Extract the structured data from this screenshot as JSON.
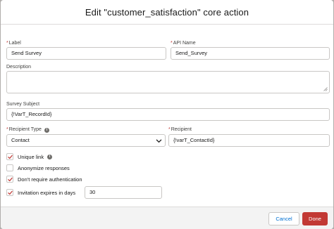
{
  "modal": {
    "title": "Edit \"customer_satisfaction\" core action"
  },
  "fields": {
    "label": {
      "label": "Label",
      "value": "Send Survey",
      "required": "*"
    },
    "api_name": {
      "label": "API Name",
      "value": "Send_Survey",
      "required": "*"
    },
    "description": {
      "label": "Description",
      "value": ""
    },
    "survey_subject": {
      "label": "Survey Subject",
      "value": "{!VarT_RecordId}"
    },
    "recipient_type": {
      "label": "Recipient Type",
      "value": "Contact",
      "required": "*"
    },
    "recipient": {
      "label": "Recipient",
      "value": "{!varT_ContactId}",
      "required": "*"
    }
  },
  "options": {
    "unique_link": {
      "label": "Unique link",
      "checked": true
    },
    "anonymize": {
      "label": "Anonymize responses",
      "checked": false
    },
    "dont_require_auth": {
      "label": "Don't require authentication",
      "checked": true
    },
    "invitation_expires": {
      "label": "Invitation expires in days",
      "checked": true,
      "value": "30"
    }
  },
  "footer": {
    "cancel_label": "Cancel",
    "done_label": "Done"
  },
  "colors": {
    "required": "#c23934",
    "primary_button": "#c23934",
    "link": "#0070d2",
    "check": "#c23934"
  },
  "icons": {
    "info": "info-icon",
    "dropdown": "chevron-down-icon",
    "checkmark": "checkmark-icon",
    "resize": "resize-handle-icon"
  }
}
